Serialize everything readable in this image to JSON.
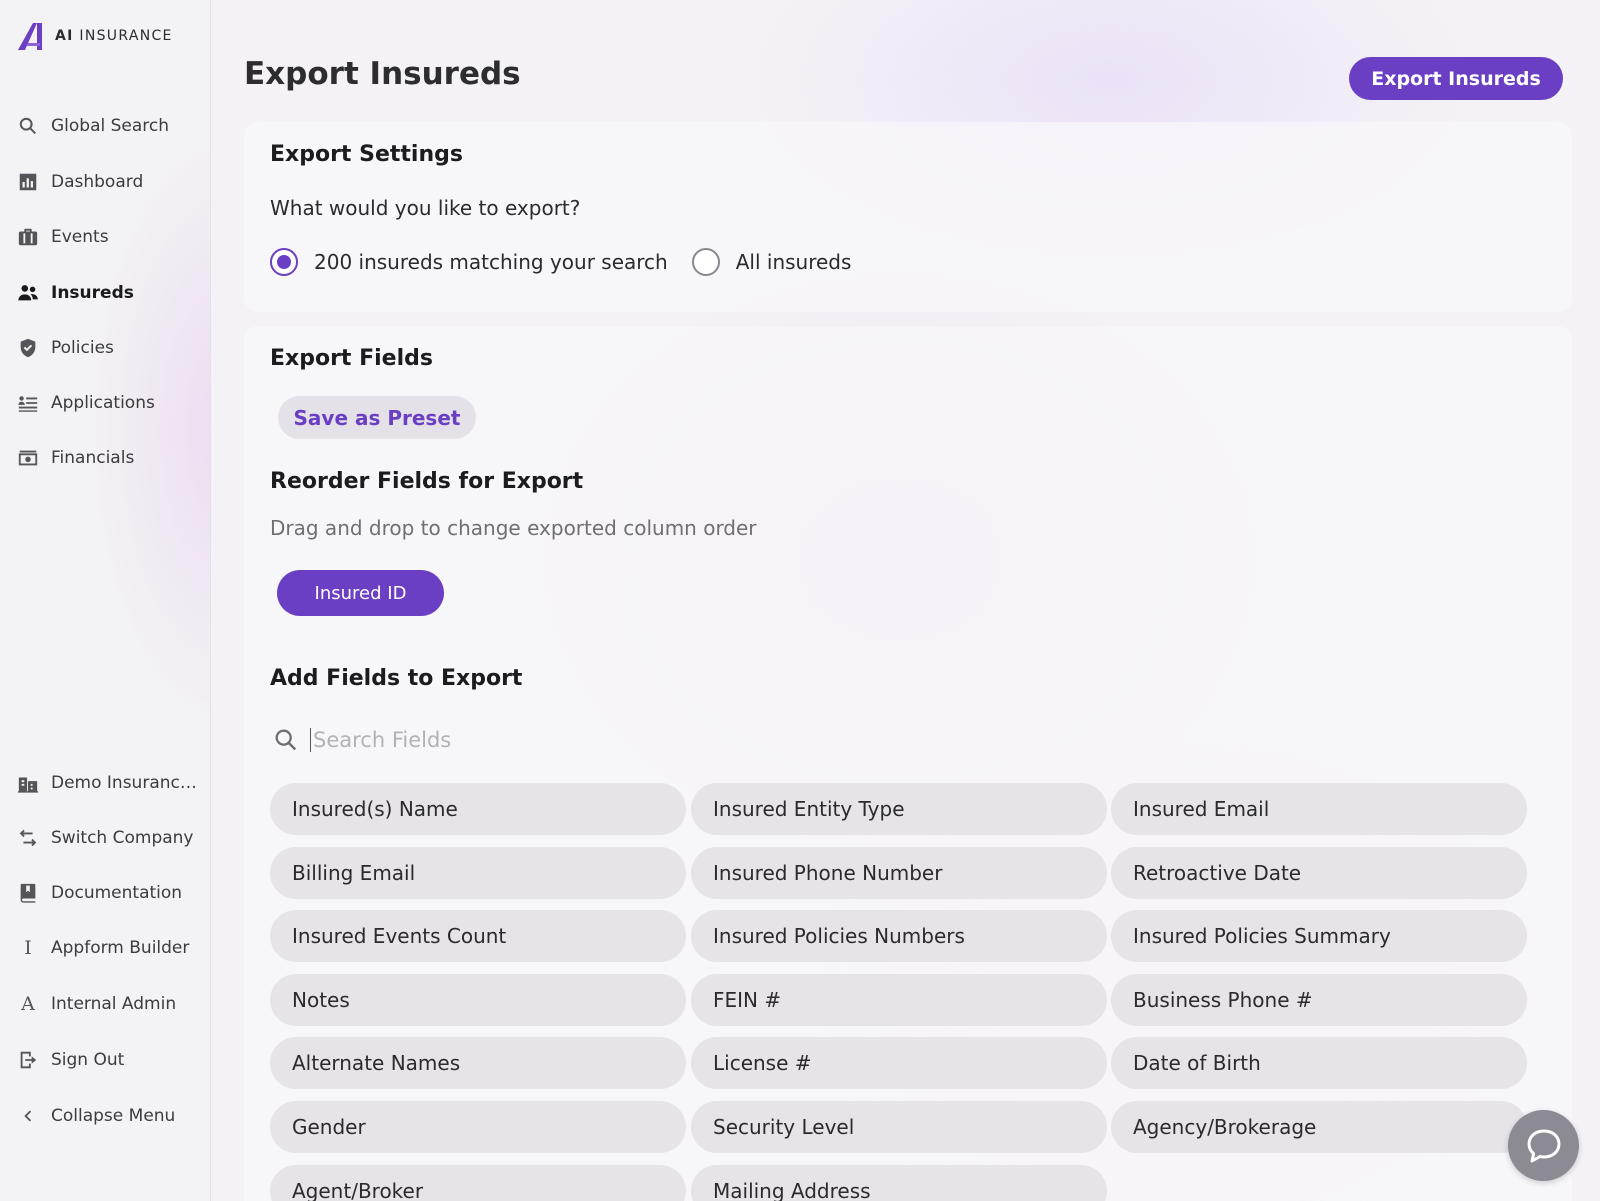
{
  "brand": {
    "prefix": "AI",
    "name": "INSURANCE"
  },
  "colors": {
    "accent": "#6a3fc4",
    "chip_bg": "#e6e3e9",
    "sidebar_bg": "#f3f2f4"
  },
  "sidebar": {
    "items": [
      {
        "label": "Global Search",
        "icon": "search-icon",
        "active": false
      },
      {
        "label": "Dashboard",
        "icon": "bar-chart-icon",
        "active": false
      },
      {
        "label": "Events",
        "icon": "briefcase-icon",
        "active": false
      },
      {
        "label": "Insureds",
        "icon": "users-icon",
        "active": true
      },
      {
        "label": "Policies",
        "icon": "shield-check-icon",
        "active": false
      },
      {
        "label": "Applications",
        "icon": "list-icon",
        "active": false
      },
      {
        "label": "Financials",
        "icon": "money-icon",
        "active": false
      }
    ],
    "bottom_items": [
      {
        "label": "Demo Insurance Company",
        "icon": "building-icon"
      },
      {
        "label": "Switch Company",
        "icon": "swap-arrows-icon"
      },
      {
        "label": "Documentation",
        "icon": "book-icon"
      },
      {
        "label": "Appform Builder",
        "icon": "letter-i-icon",
        "glyph": "I"
      },
      {
        "label": "Internal Admin",
        "icon": "letter-a-icon",
        "glyph": "A"
      },
      {
        "label": "Sign Out",
        "icon": "sign-out-icon"
      },
      {
        "label": "Collapse Menu",
        "icon": "chevron-left-icon"
      }
    ]
  },
  "header": {
    "title": "Export Insureds",
    "export_button": "Export Insureds"
  },
  "settings": {
    "title": "Export Settings",
    "question": "What would you like to export?",
    "options": [
      {
        "label": "200 insureds matching your search",
        "checked": true
      },
      {
        "label": "All insureds",
        "checked": false
      }
    ]
  },
  "fields": {
    "title": "Export Fields",
    "preset_button": "Save as Preset",
    "reorder_title": "Reorder Fields for Export",
    "reorder_hint": "Drag and drop to change exported column order",
    "selected": [
      "Insured ID"
    ],
    "add_title": "Add Fields to Export",
    "search_placeholder": "Search Fields",
    "search_value": "",
    "available": [
      "Insured(s) Name",
      "Insured Entity Type",
      "Insured Email",
      "Billing Email",
      "Insured Phone Number",
      "Retroactive Date",
      "Insured Events Count",
      "Insured Policies Numbers",
      "Insured Policies Summary",
      "Notes",
      "FEIN #",
      "Business Phone #",
      "Alternate Names",
      "License #",
      "Date of Birth",
      "Gender",
      "Security Level",
      "Agency/Brokerage",
      "Agent/Broker",
      "Mailing Address"
    ]
  }
}
